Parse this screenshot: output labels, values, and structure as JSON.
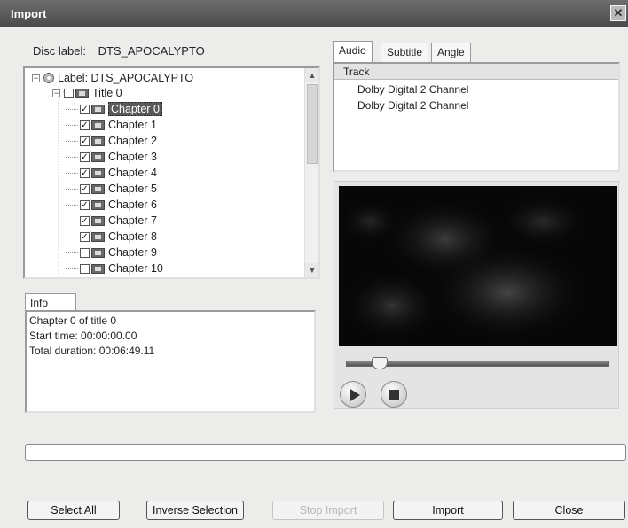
{
  "window": {
    "title": "Import",
    "close_glyph": "✕"
  },
  "disc": {
    "label_caption": "Disc label:",
    "label_value": "DTS_APOCALYPTO"
  },
  "tree": {
    "root_label": "Label: DTS_APOCALYPTO",
    "title_label": "Title 0",
    "chapters": [
      {
        "label": "Chapter 0",
        "checked": true,
        "selected": true
      },
      {
        "label": "Chapter 1",
        "checked": true
      },
      {
        "label": "Chapter 2",
        "checked": true
      },
      {
        "label": "Chapter 3",
        "checked": true
      },
      {
        "label": "Chapter 4",
        "checked": true
      },
      {
        "label": "Chapter 5",
        "checked": true
      },
      {
        "label": "Chapter 6",
        "checked": true
      },
      {
        "label": "Chapter 7",
        "checked": true
      },
      {
        "label": "Chapter 8",
        "checked": true
      },
      {
        "label": "Chapter 9",
        "checked": false
      },
      {
        "label": "Chapter 10",
        "checked": false
      }
    ]
  },
  "info": {
    "tab_label": "Info",
    "lines": [
      "Chapter 0 of title 0",
      "Start time: 00:00:00.00",
      "Total duration: 00:06:49.11"
    ]
  },
  "media_tabs": [
    "Audio",
    "Subtitle",
    "Angle"
  ],
  "audio": {
    "column_header": "Track",
    "tracks": [
      "Dolby Digital 2 Channel",
      "Dolby Digital 2 Channel"
    ]
  },
  "player": {
    "position_fraction": 0.1
  },
  "buttons": {
    "select_all": "Select All",
    "inverse_selection": "Inverse Selection",
    "stop_import": "Stop Import",
    "import": "Import",
    "close": "Close"
  },
  "progress": {
    "value_fraction": 0
  }
}
